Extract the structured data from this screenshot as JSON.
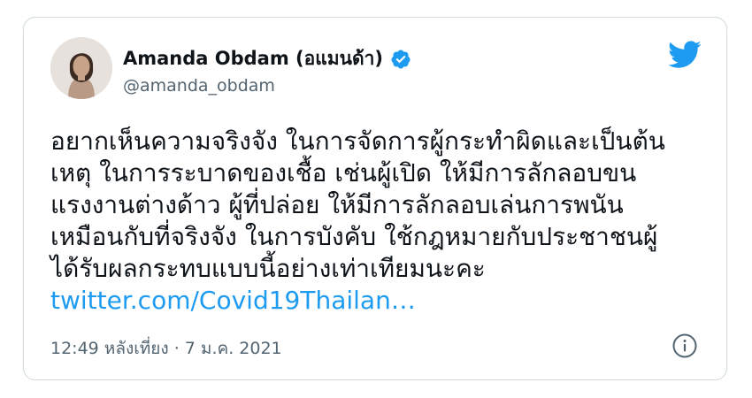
{
  "tweet": {
    "author": {
      "display_name": "Amanda Obdam (อแมนด้า)",
      "handle": "@amanda_obdam",
      "verified": true
    },
    "text_lines": [
      "อยากเห็นความจริงจัง ในการจัดการผู้กระทำผิดและเป็นต้น",
      "เหตุ ในการระบาดของเชื้อ เช่นผู้เปิด ให้มีการลักลอบขน",
      "แรงงานต่างด้าว ผู้ที่ปล่อย ให้มีการลักลอบเล่นการพนัน",
      "เหมือนกับที่จริงจัง ในการบังคับ ใช้กฎหมายกับประชาชนผู้",
      "ได้รับผลกระทบแบบนี้อย่างเท่าเทียมนะคะ"
    ],
    "link_text": "twitter.com/Covid19Thailan…",
    "timestamp": "12:49 หลังเที่ยง · 7 ม.ค. 2021"
  },
  "icons": {
    "brand": "twitter-bird-icon",
    "verified": "verified-badge-icon",
    "info": "info-icon"
  },
  "colors": {
    "brand_blue": "#1d9bf0",
    "text_primary": "#0f1419",
    "text_secondary": "#536471",
    "border": "#cfd9de"
  }
}
